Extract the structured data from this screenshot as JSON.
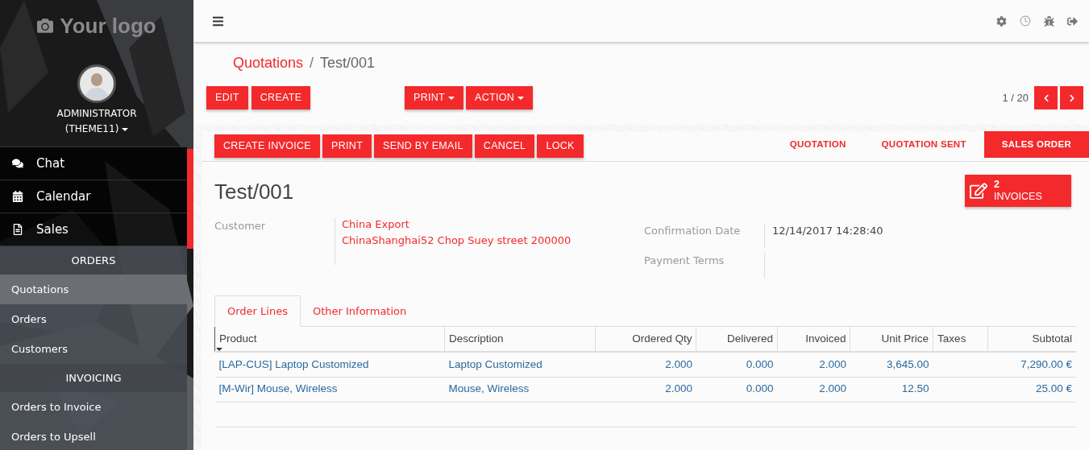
{
  "sidebar": {
    "logo": "Your logo",
    "user": {
      "name": "ADMINISTRATOR",
      "company": "(THEME11)"
    },
    "apps": [
      {
        "label": "Chat"
      },
      {
        "label": "Calendar"
      },
      {
        "label": "Sales"
      }
    ],
    "sections": [
      {
        "title": "ORDERS",
        "items": [
          {
            "label": "Quotations",
            "selected": true
          },
          {
            "label": "Orders",
            "selected": false
          },
          {
            "label": "Customers",
            "selected": false
          }
        ]
      },
      {
        "title": "INVOICING",
        "items": [
          {
            "label": "Orders to Invoice",
            "selected": false
          },
          {
            "label": "Orders to Upsell",
            "selected": false
          }
        ]
      }
    ]
  },
  "breadcrumb": {
    "parent": "Quotations",
    "separator": "/",
    "current": "Test/001"
  },
  "buttons": [
    {
      "label": "EDIT",
      "dropdown": false
    },
    {
      "label": "CREATE",
      "dropdown": false
    }
  ],
  "menus": [
    {
      "label": "PRINT",
      "dropdown": true
    },
    {
      "label": "ACTION",
      "dropdown": true
    }
  ],
  "pager": "1 / 20",
  "header_buttons": [
    "CREATE INVOICE",
    "PRINT",
    "SEND BY EMAIL",
    "CANCEL",
    "LOCK"
  ],
  "stages": [
    {
      "label": "QUOTATION",
      "selected": false
    },
    {
      "label": "QUOTATION SENT",
      "selected": false
    },
    {
      "label": "SALES ORDER",
      "selected": true
    }
  ],
  "title": "Test/001",
  "smart_button": {
    "count": "2",
    "label": "INVOICES"
  },
  "fields_left": [
    {
      "label": "Customer",
      "lines": [
        "China Export",
        "ChinaShanghai52 Chop Suey street 200000"
      ]
    }
  ],
  "fields_right": [
    {
      "label": "Confirmation Date",
      "value": "12/14/2017 14:28:40"
    },
    {
      "label": "Payment Terms"
    }
  ],
  "tabs": [
    {
      "label": "Order Lines",
      "selected": true
    },
    {
      "label": "Other Information",
      "selected": false
    }
  ],
  "table": {
    "columns": [
      "Product",
      "Description",
      "Ordered Qty",
      "Delivered",
      "Invoiced",
      "Unit Price",
      "Taxes",
      "Subtotal"
    ],
    "rows": [
      [
        "[LAP-CUS] Laptop Customized",
        "Laptop Customized",
        "2.000",
        "0.000",
        "2.000",
        "3,645.00",
        "",
        "7,290.00 €"
      ],
      [
        "[M-Wir] Mouse, Wireless",
        "Mouse, Wireless",
        "2.000",
        "0.000",
        "2.000",
        "12.50",
        "",
        "25.00 €"
      ]
    ]
  }
}
